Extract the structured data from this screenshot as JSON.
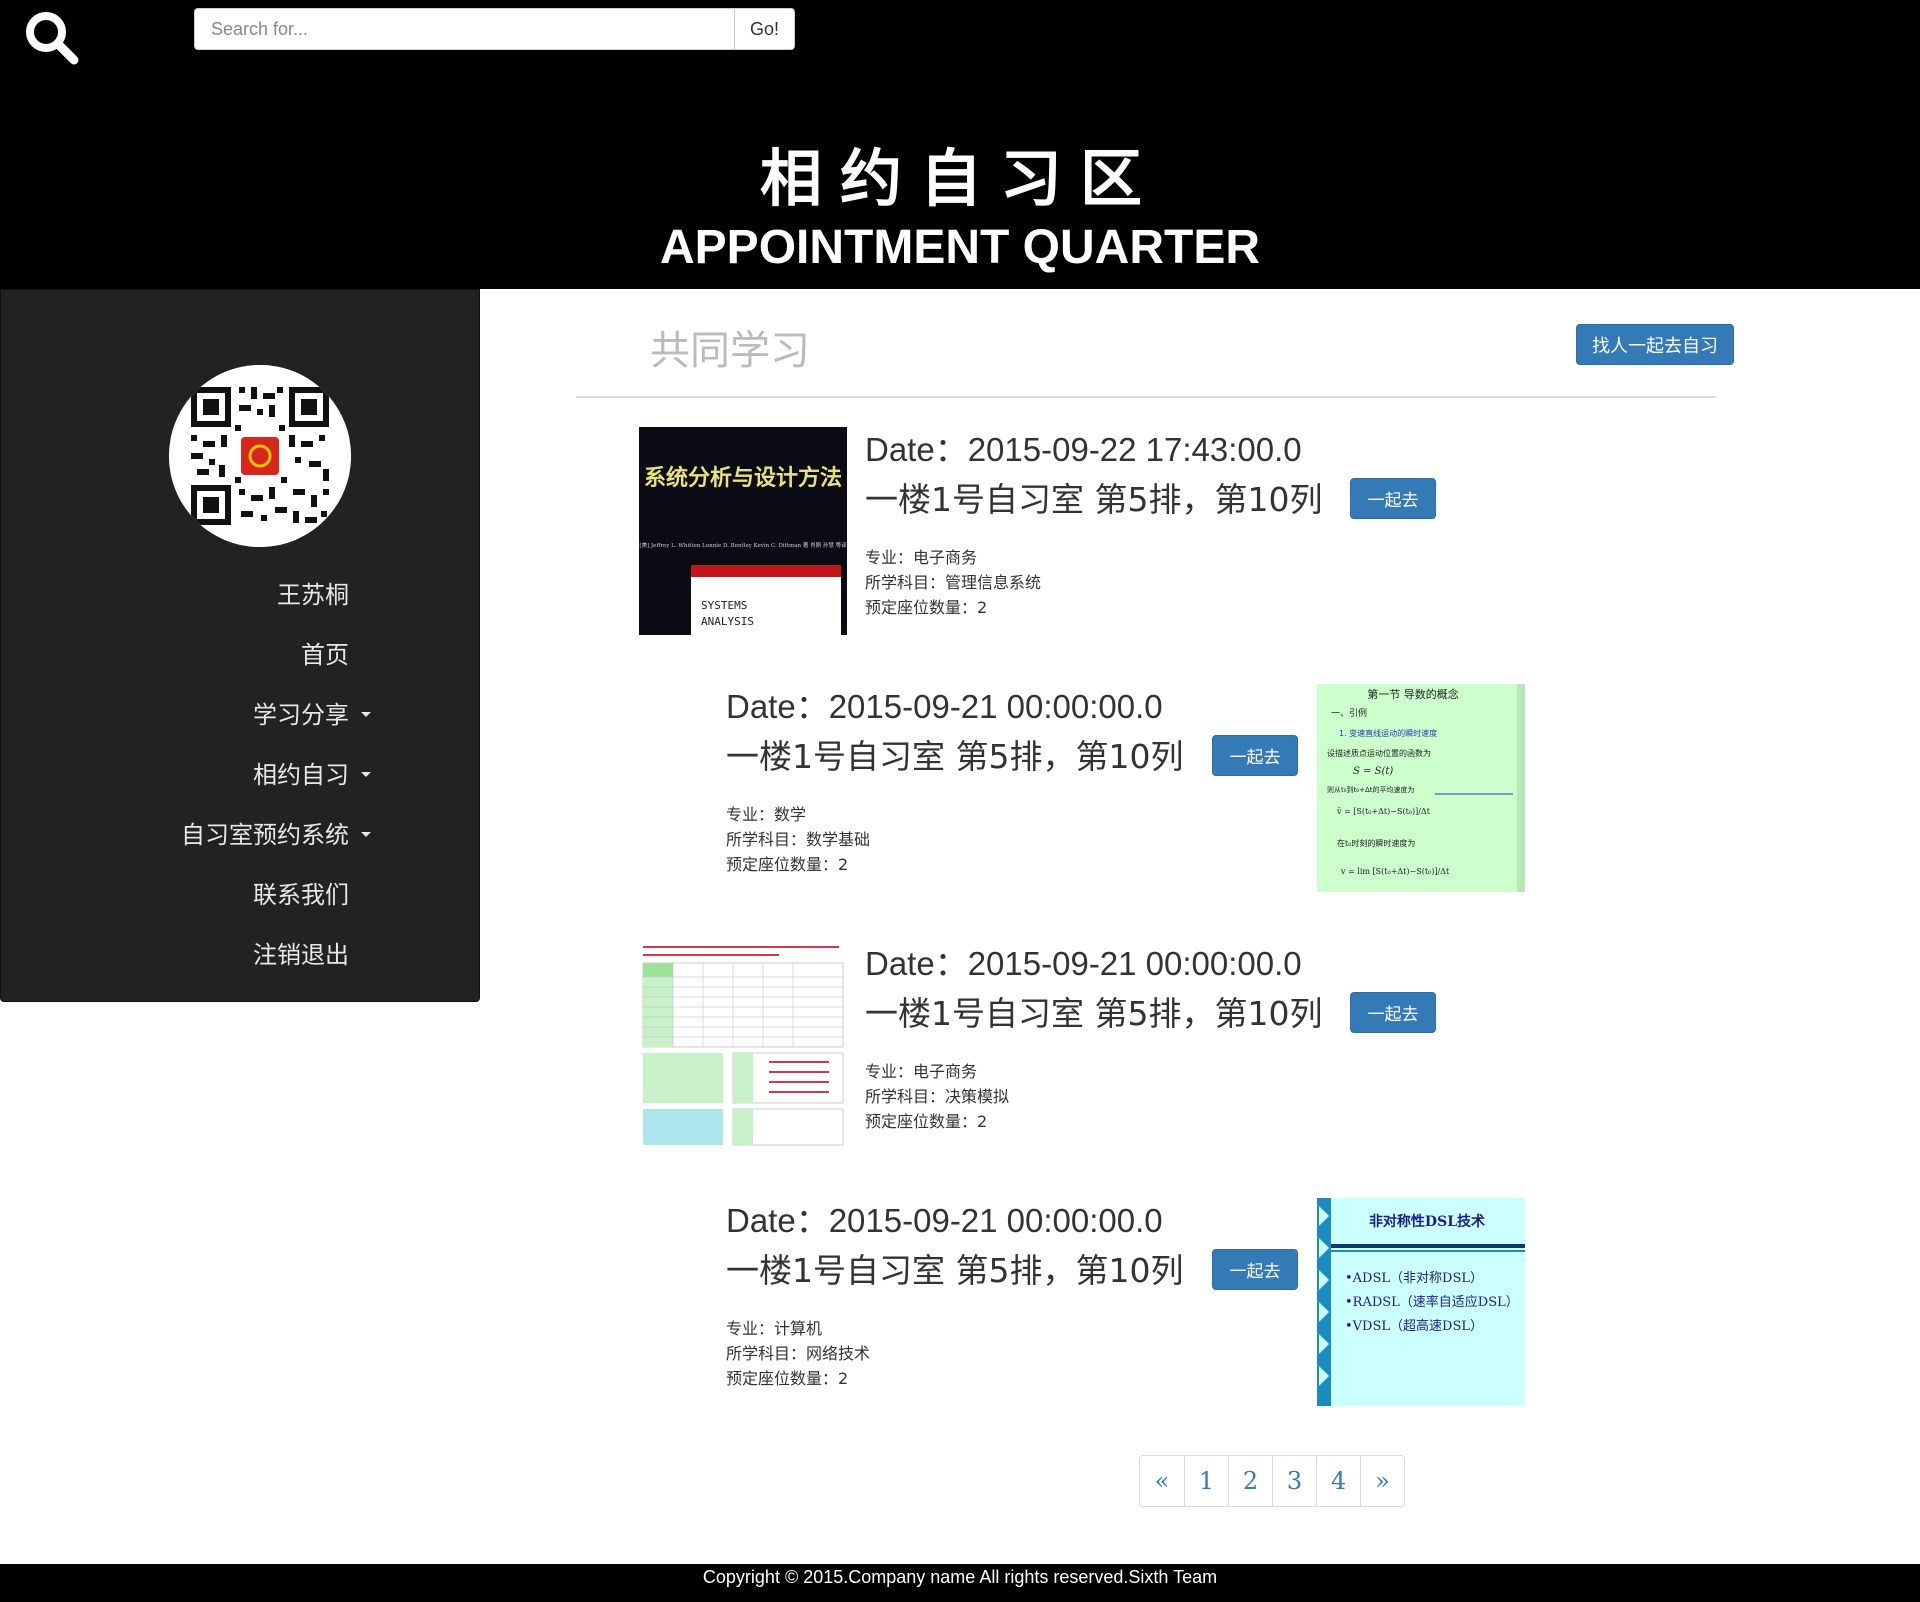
{
  "header": {
    "search_placeholder": "Search for...",
    "search_button": "Go!",
    "title_cn": "相约自习区",
    "title_en": "APPOINTMENT QUARTER"
  },
  "sidebar": {
    "username": "王苏桐",
    "items": [
      {
        "label": "首页",
        "has_caret": false
      },
      {
        "label": "学习分享",
        "has_caret": true
      },
      {
        "label": "相约自习",
        "has_caret": true
      },
      {
        "label": "自习室预约系统",
        "has_caret": true
      },
      {
        "label": "联系我们",
        "has_caret": false
      },
      {
        "label": "注销退出",
        "has_caret": false
      }
    ]
  },
  "main": {
    "section_title": "共同学习",
    "find_button": "找人一起去自习",
    "go_label": "一起去",
    "cards": [
      {
        "date": "Date：2015-09-22 17:43:00.0",
        "room": "一楼1号自习室 第5排，第10列",
        "major": "专业：电子商务",
        "subject": "所学科目：管理信息系统",
        "seats": "预定座位数量：2",
        "thumb_title": "系统分析与设计方法",
        "thumb_authors": "[美] Jeffrey L. Whitten  Lonnie D. Bentley  Kevin C. Dittman 著  肖刚 孙慧 等译",
        "thumb_en": "SYSTEMS\nANALYSIS"
      },
      {
        "date": "Date：2015-09-21 00:00:00.0",
        "room": "一楼1号自习室 第5排，第10列",
        "major": "专业：数学",
        "subject": "所学科目：数学基础",
        "seats": "预定座位数量：2",
        "thumb_title": "第一节  导数的概念",
        "thumb_lines": [
          "一、引例",
          "1.  变速直线运动的瞬时速度",
          "设描述质点运动位置的函数为",
          "S = S(t)",
          "则从t₀到t₀+Δt的平均速度为",
          "v̄ = [S(t₀+Δt)−S(t₀)]/Δt",
          "在t₀时刻的瞬时速度为",
          "v = lim [S(t₀+Δt)−S(t₀)]/Δt"
        ]
      },
      {
        "date": "Date：2015-09-21 00:00:00.0",
        "room": "一楼1号自习室 第5排，第10列",
        "major": "专业：电子商务",
        "subject": "所学科目：决策模拟",
        "seats": "预定座位数量：2"
      },
      {
        "date": "Date：2015-09-21 00:00:00.0",
        "room": "一楼1号自习室 第5排，第10列",
        "major": "专业：计算机",
        "subject": "所学科目：网络技术",
        "seats": "预定座位数量：2",
        "thumb_title": "非对称性DSL技术",
        "thumb_lines": [
          "•ADSL（非对称DSL）",
          "•RADSL（速率自适应DSL）",
          "•VDSL（超高速DSL）"
        ]
      }
    ]
  },
  "pagination": [
    "«",
    "1",
    "2",
    "3",
    "4",
    "»"
  ],
  "footer": {
    "copyright": "Copyright © 2015.Company name All rights reserved.Sixth Team"
  },
  "colors": {
    "primary": "#337ab7",
    "header_bg": "#000000",
    "sidebar_bg": "#222222"
  }
}
